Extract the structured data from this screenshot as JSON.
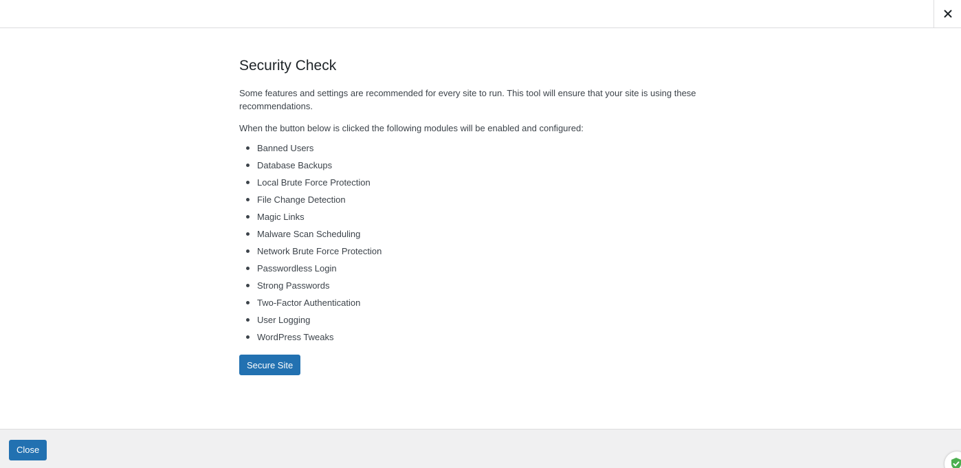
{
  "header": {
    "close_icon": "close-x-icon"
  },
  "main": {
    "title": "Security Check",
    "intro": "Some features and settings are recommended for every site to run. This tool will ensure that your site is using these recommendations.",
    "lead": "When the button below is clicked the following modules will be enabled and configured:",
    "modules": [
      "Banned Users",
      "Database Backups",
      "Local Brute Force Protection",
      "File Change Detection",
      "Magic Links",
      "Malware Scan Scheduling",
      "Network Brute Force Protection",
      "Passwordless Login",
      "Strong Passwords",
      "Two-Factor Authentication",
      "User Logging",
      "WordPress Tweaks"
    ],
    "secure_button_label": "Secure Site"
  },
  "footer": {
    "close_button_label": "Close",
    "badge_icon": "shield-check-icon"
  },
  "colors": {
    "primary_button": "#2271b1",
    "footer_bg": "#f0f0f1",
    "badge_green": "#4caf50"
  }
}
